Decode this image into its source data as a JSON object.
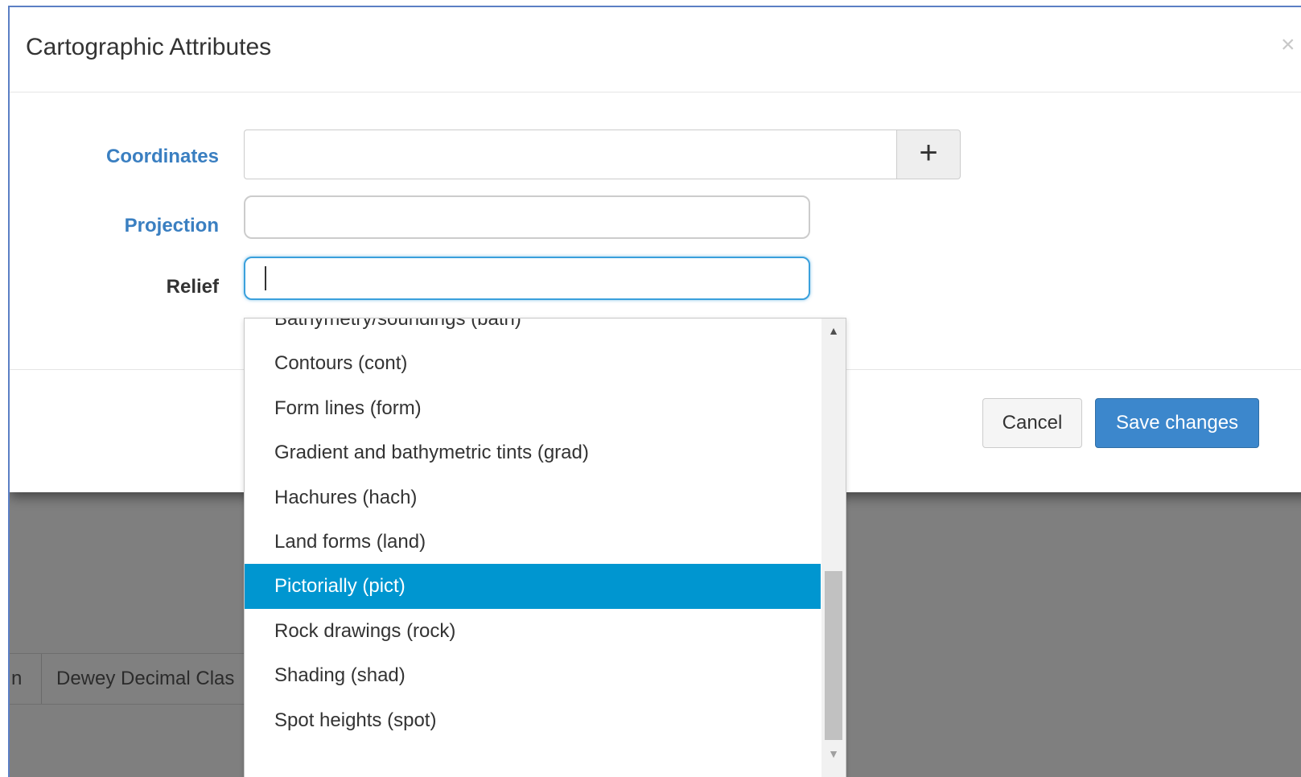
{
  "modal": {
    "title": "Cartographic Attributes",
    "close_glyph": "×"
  },
  "form": {
    "coordinates_label": "Coordinates",
    "coordinates_value": "",
    "add_glyph": "+",
    "projection_label": "Projection",
    "projection_value": "",
    "relief_label": "Relief",
    "relief_value": ""
  },
  "footer": {
    "cancel_label": "Cancel",
    "save_label": "Save changes"
  },
  "relief_options": [
    "Bathymetry/soundings (bath)",
    "Contours (cont)",
    "Form lines (form)",
    "Gradient and bathymetric tints (grad)",
    "Hachures (hach)",
    "Land forms (land)",
    "Pictorially (pict)",
    "Rock drawings (rock)",
    "Shading (shad)",
    "Spot heights (spot)"
  ],
  "selected_option_index": 6,
  "background_table": {
    "col1_fragment": "n",
    "col2_fragment": "Dewey Decimal Clas"
  },
  "colors": {
    "link_label": "#3a7fc1",
    "primary": "#3c87cc",
    "selected_option": "#0096d0",
    "focus_border": "#3aa0dc"
  }
}
